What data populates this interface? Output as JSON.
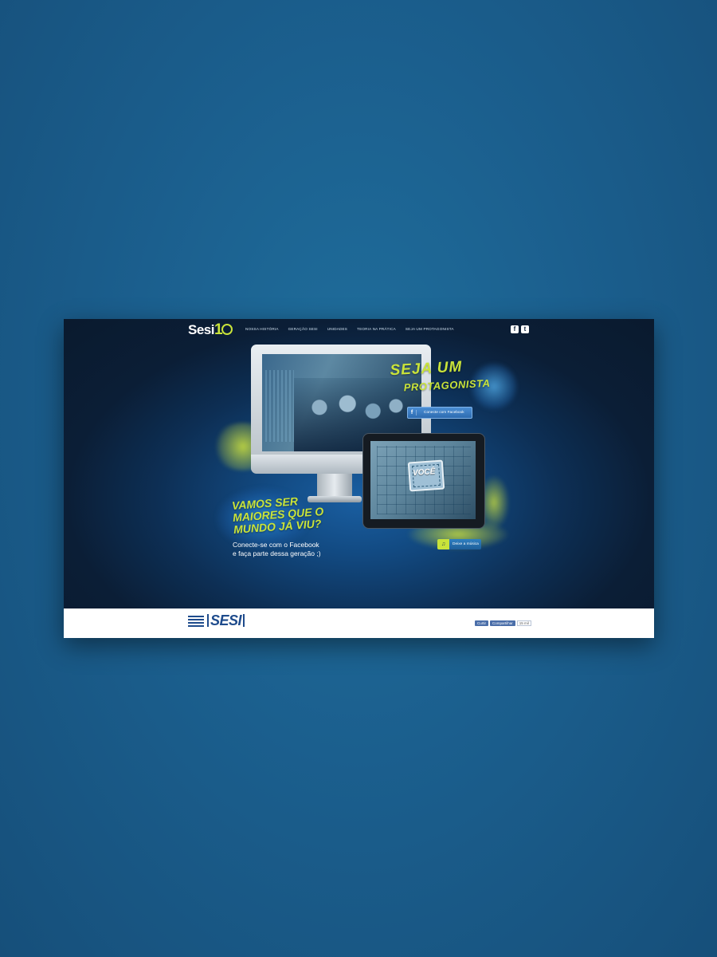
{
  "header": {
    "logo_text": "Sesi",
    "logo_number": "1",
    "nav": [
      "NOSSA HISTÓRIA",
      "GERAÇÃO SESI",
      "UNIDADES",
      "TEORIA NA PRÁTICA",
      "SEJA UM PROTAGONISTA"
    ],
    "social": [
      {
        "icon": "facebook-icon",
        "glyph": "f"
      },
      {
        "icon": "twitter-icon",
        "glyph": "t"
      }
    ]
  },
  "hero": {
    "headline_line1": "SEJA UM",
    "headline_line2": "PROTAGONISTA",
    "fb_button": "Conecte com Facebook",
    "tablet_label": "VOCÊ",
    "slogan": [
      "VAMOS SER",
      "MAIORES QUE O",
      "MUNDO JÁ VIU?"
    ],
    "sub": [
      "Conecte-se com o Facebook",
      "e faça parte dessa geração ;)"
    ],
    "play_button": "Deixe a música",
    "colors": {
      "accent": "#c9e33a",
      "background": "#0b1e36",
      "button": "#2d6bb0"
    }
  },
  "footer": {
    "logo": "SESI",
    "like": "Curtir",
    "share": "Compartilhar",
    "count": "15 mil"
  }
}
